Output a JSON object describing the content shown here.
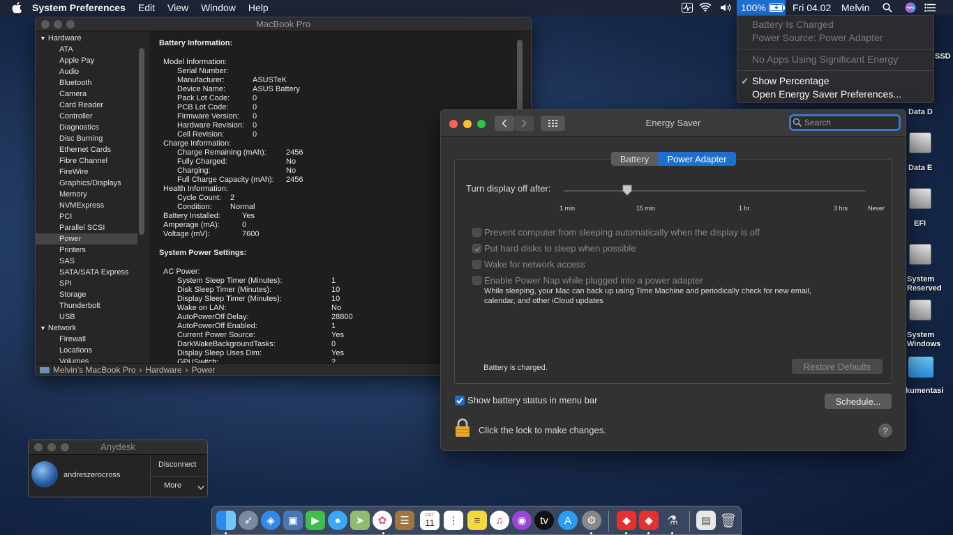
{
  "menubar": {
    "app_name": "System Preferences",
    "menus": [
      "Edit",
      "View",
      "Window",
      "Help"
    ],
    "battery_percent": "100%",
    "datetime": "Fri 04.02",
    "user": "Melvin"
  },
  "battery_menu": {
    "status": "Battery Is Charged",
    "power_source": "Power Source: Power Adapter",
    "apps": "No Apps Using Significant Energy",
    "show_percentage": "Show Percentage",
    "show_percentage_check": "✓",
    "open_prefs": "Open Energy Saver Preferences..."
  },
  "sysinfo": {
    "title": "MacBook Pro",
    "sidebar": {
      "hardware_group": "Hardware",
      "hardware_items": [
        "ATA",
        "Apple Pay",
        "Audio",
        "Bluetooth",
        "Camera",
        "Card Reader",
        "Controller",
        "Diagnostics",
        "Disc Burning",
        "Ethernet Cards",
        "Fibre Channel",
        "FireWire",
        "Graphics/Displays",
        "Memory",
        "NVMExpress",
        "PCI",
        "Parallel SCSI",
        "Power",
        "Printers",
        "SAS",
        "SATA/SATA Express",
        "SPI",
        "Storage",
        "Thunderbolt",
        "USB"
      ],
      "network_group": "Network",
      "network_items": [
        "Firewall",
        "Locations",
        "Volumes"
      ],
      "selected": "Power"
    },
    "content": {
      "battery_heading": "Battery Information:",
      "model_heading": "Model Information:",
      "model": [
        {
          "k": "Serial Number:",
          "v": ""
        },
        {
          "k": "Manufacturer:",
          "v": "ASUSTeK"
        },
        {
          "k": "Device Name:",
          "v": "ASUS Battery"
        },
        {
          "k": "Pack Lot Code:",
          "v": "0"
        },
        {
          "k": "PCB Lot Code:",
          "v": "0"
        },
        {
          "k": "Firmware Version:",
          "v": "0"
        },
        {
          "k": "Hardware Revision:",
          "v": "0"
        },
        {
          "k": "Cell Revision:",
          "v": "0"
        }
      ],
      "charge_heading": "Charge Information:",
      "charge": [
        {
          "k": "Charge Remaining (mAh):",
          "v": "2456"
        },
        {
          "k": "Fully Charged:",
          "v": "No"
        },
        {
          "k": "Charging:",
          "v": "No"
        },
        {
          "k": "Full Charge Capacity (mAh):",
          "v": "2456"
        }
      ],
      "health_heading": "Health Information:",
      "health": [
        {
          "k": "Cycle Count:",
          "v": "2"
        },
        {
          "k": "Condition:",
          "v": "Normal"
        }
      ],
      "battery_misc": [
        {
          "k": "Battery Installed:",
          "v": "Yes"
        },
        {
          "k": "Amperage (mA):",
          "v": "0"
        },
        {
          "k": "Voltage (mV):",
          "v": "7600"
        }
      ],
      "power_heading": "System Power Settings:",
      "ac_heading": "AC Power:",
      "ac": [
        {
          "k": "System Sleep Timer (Minutes):",
          "v": "1"
        },
        {
          "k": "Disk Sleep Timer (Minutes):",
          "v": "10"
        },
        {
          "k": "Display Sleep Timer (Minutes):",
          "v": "10"
        },
        {
          "k": "Wake on LAN:",
          "v": "No"
        },
        {
          "k": "AutoPowerOff Delay:",
          "v": "28800"
        },
        {
          "k": "AutoPowerOff Enabled:",
          "v": "1"
        },
        {
          "k": "Current Power Source:",
          "v": "Yes"
        },
        {
          "k": "DarkWakeBackgroundTasks:",
          "v": "0"
        },
        {
          "k": "Display Sleep Uses Dim:",
          "v": "Yes"
        },
        {
          "k": "GPUSwitch:",
          "v": "2"
        }
      ]
    },
    "pathbar": {
      "computer": "Melvin’s MacBook Pro",
      "sep": "›",
      "hardware": "Hardware",
      "power": "Power"
    }
  },
  "energy": {
    "title": "Energy Saver",
    "search_placeholder": "Search",
    "tabs": {
      "battery": "Battery",
      "power_adapter": "Power Adapter"
    },
    "slider_label": "Turn display off after:",
    "slider_ticks": [
      "1 min",
      "15 min",
      "1 hr",
      "3 hrs",
      "Never"
    ],
    "options": [
      {
        "label": "Prevent computer from sleeping automatically when the display is off",
        "checked": false
      },
      {
        "label": "Put hard disks to sleep when possible",
        "checked": true
      },
      {
        "label": "Wake for network access",
        "checked": false
      },
      {
        "label": "Enable Power Nap while plugged into a power adapter",
        "checked": false
      }
    ],
    "power_nap_desc_1": "While sleeping, your Mac can back up using Time Machine and periodically check for new email,",
    "power_nap_desc_2": "calendar, and other iCloud updates",
    "battery_charged": "Battery is charged.",
    "restore_defaults": "Restore Defaults",
    "show_status": "Show battery status in menu bar",
    "schedule": "Schedule...",
    "lock_text": "Click the lock to make changes.",
    "help": "?"
  },
  "anydesk": {
    "title": "Anydesk",
    "user": "andreszerocross",
    "disconnect": "Disconnect",
    "more": "More"
  },
  "desktop_labels": [
    "SSD",
    "Data D",
    "Data E",
    "EFI",
    "System",
    "Reserved",
    "System",
    "Windows",
    "kumentasi"
  ],
  "dock_calendar": {
    "month": "OCT",
    "day": "11"
  }
}
